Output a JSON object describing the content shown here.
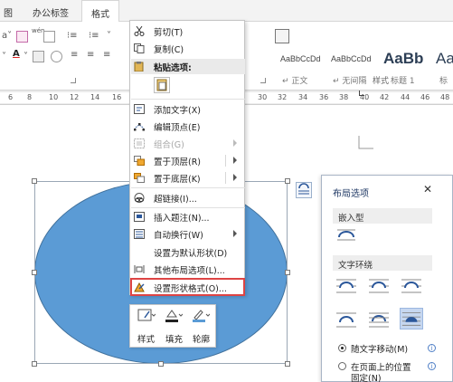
{
  "tabs": [
    {
      "label": "图",
      "active": false
    },
    {
      "label": "办公标签",
      "active": false
    },
    {
      "label": "格式",
      "active": true
    }
  ],
  "ribbon": {
    "font": {
      "wen_label": "wén"
    },
    "styles": {
      "items": [
        {
          "preview": "AaBbCcDd",
          "name": "↵ 正文"
        },
        {
          "preview": "AaBbCcDd",
          "name": "↵ 无间隔"
        },
        {
          "preview": "AaBb",
          "name": "标题 1"
        },
        {
          "preview": "Aa",
          "name": "标"
        }
      ],
      "group_label": "样式"
    }
  },
  "ruler": {
    "ticks": [
      "6",
      "8",
      "10",
      "12",
      "14",
      "16",
      "30",
      "32",
      "34",
      "36",
      "38",
      "40",
      "42",
      "44",
      "46",
      "48"
    ]
  },
  "context_menu": {
    "items": [
      {
        "label": "剪切(T)",
        "icon": "scissors-icon",
        "enabled": true
      },
      {
        "label": "复制(C)",
        "icon": "copy-icon",
        "enabled": true
      },
      {
        "label": "粘贴选项:",
        "icon": "paste-icon",
        "enabled": true
      },
      {
        "label": "添加文字(X)",
        "icon": "add-text-icon",
        "enabled": true
      },
      {
        "label": "编辑顶点(E)",
        "icon": "edit-points-icon",
        "enabled": true
      },
      {
        "label": "组合(G)",
        "icon": "group-icon",
        "enabled": false,
        "submenu": true
      },
      {
        "label": "置于顶层(R)",
        "icon": "bring-front-icon",
        "enabled": true,
        "submenu": true
      },
      {
        "label": "置于底层(K)",
        "icon": "send-back-icon",
        "enabled": true,
        "submenu": true
      },
      {
        "label": "超链接(I)...",
        "icon": "hyperlink-icon",
        "enabled": true
      },
      {
        "label": "插入题注(N)...",
        "icon": "caption-icon",
        "enabled": true
      },
      {
        "label": "自动换行(W)",
        "icon": "wrap-text-icon",
        "enabled": true,
        "submenu": true
      },
      {
        "label": "设置为默认形状(D)",
        "icon": "",
        "enabled": true
      },
      {
        "label": "其他布局选项(L)...",
        "icon": "layout-options-icon",
        "enabled": true
      },
      {
        "label": "设置形状格式(O)...",
        "icon": "format-shape-icon",
        "enabled": true,
        "highlighted": true
      }
    ]
  },
  "mini_toolbar": {
    "buttons": [
      {
        "label": "样式",
        "icon": "shape-style-icon"
      },
      {
        "label": "填充",
        "icon": "fill-bucket-icon"
      },
      {
        "label": "轮廓",
        "icon": "outline-pen-icon"
      }
    ]
  },
  "layout_panel": {
    "title": "布局选项",
    "close": "✕",
    "inline_section": "嵌入型",
    "wrap_section": "文字环绕",
    "move_with_text": "随文字移动(M)",
    "fix_position_line1": "在页面上的位置",
    "fix_position_line2": "固定(N)"
  },
  "colors": {
    "ellipse_fill": "#5b9bd5",
    "accent": "#2b579a",
    "highlight_border": "#d44444"
  }
}
